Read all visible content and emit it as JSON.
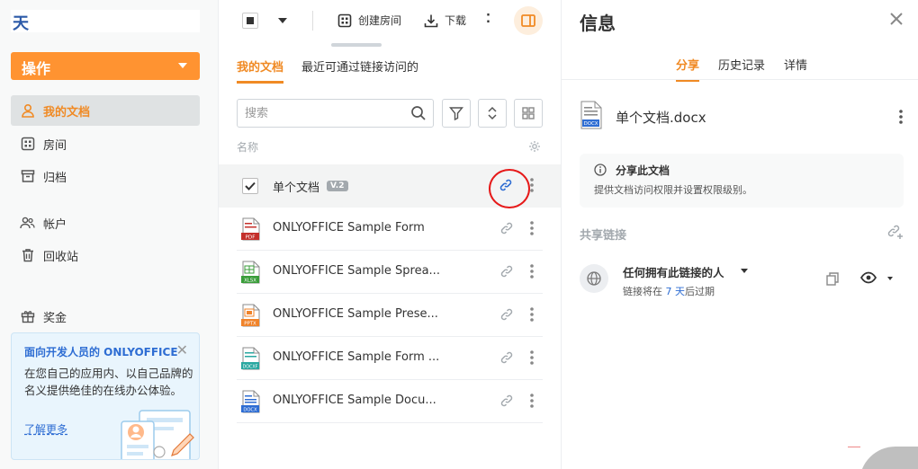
{
  "sidebar": {
    "logo_glyph": "天",
    "actions_label": "操作",
    "items": [
      {
        "label": "我的文档",
        "icon": "person-icon",
        "active": true
      },
      {
        "label": "房间",
        "icon": "rooms-grid-icon",
        "active": false
      },
      {
        "label": "归档",
        "icon": "archive-icon",
        "active": false
      },
      {
        "label": "帐户",
        "icon": "accounts-icon",
        "active": false
      },
      {
        "label": "回收站",
        "icon": "trash-icon",
        "active": false
      },
      {
        "label": "奖金",
        "icon": "gift-icon",
        "active": false
      }
    ],
    "promo": {
      "title": "面向开发人员的 ONLYOFFICE",
      "text": "在您自己的应用内、以自己品牌的名义提供绝佳的在线办公体验。",
      "link": "了解更多"
    }
  },
  "toolbar": {
    "create_room_label": "创建房间",
    "download_label": "下载",
    "more_label": "⁚"
  },
  "tabs": [
    {
      "label": "我的文档",
      "active": true
    },
    {
      "label": "最近可通过链接访问的",
      "active": false
    }
  ],
  "search": {
    "placeholder": "搜索"
  },
  "list": {
    "column_header": "名称",
    "files": [
      {
        "name": "单个文档",
        "badge": "V.2",
        "type": "docx",
        "selected": true
      },
      {
        "name": "ONLYOFFICE Sample Form",
        "type": "pdf",
        "ext_label": "PDF",
        "ext_color": "#c4302b"
      },
      {
        "name": "ONLYOFFICE Sample Sprea...",
        "type": "xlsx",
        "ext_label": "XLSX",
        "ext_color": "#3a9d3a"
      },
      {
        "name": "ONLYOFFICE Sample Prese...",
        "type": "pptx",
        "ext_label": "PPTX",
        "ext_color": "#f0832a"
      },
      {
        "name": "ONLYOFFICE Sample Form ...",
        "type": "docxf",
        "ext_label": "DOCXF",
        "ext_color": "#2aa7a0"
      },
      {
        "name": "ONLYOFFICE Sample Docu...",
        "type": "docx",
        "ext_label": "DOCX",
        "ext_color": "#2e6dd3"
      }
    ]
  },
  "info": {
    "title": "信息",
    "tabs": [
      {
        "label": "分享",
        "active": true
      },
      {
        "label": "历史记录",
        "active": false
      },
      {
        "label": "详情",
        "active": false
      }
    ],
    "doc_name": "单个文档.docx",
    "doc_ext_label": "DOCX",
    "share_box": {
      "title": "分享此文档",
      "text": "提供文档访问权限并设置权限级别。"
    },
    "shared_links_title": "共享链接",
    "link": {
      "name": "任何拥有此链接的人",
      "expiry_prefix": "链接将在 ",
      "expiry_days": "7 天",
      "expiry_suffix": "后过期"
    }
  },
  "colors": {
    "accent": "#ff9331",
    "active_text": "#f08a24",
    "link_blue": "#2e6dd3",
    "highlight_circle": "#e61919"
  }
}
